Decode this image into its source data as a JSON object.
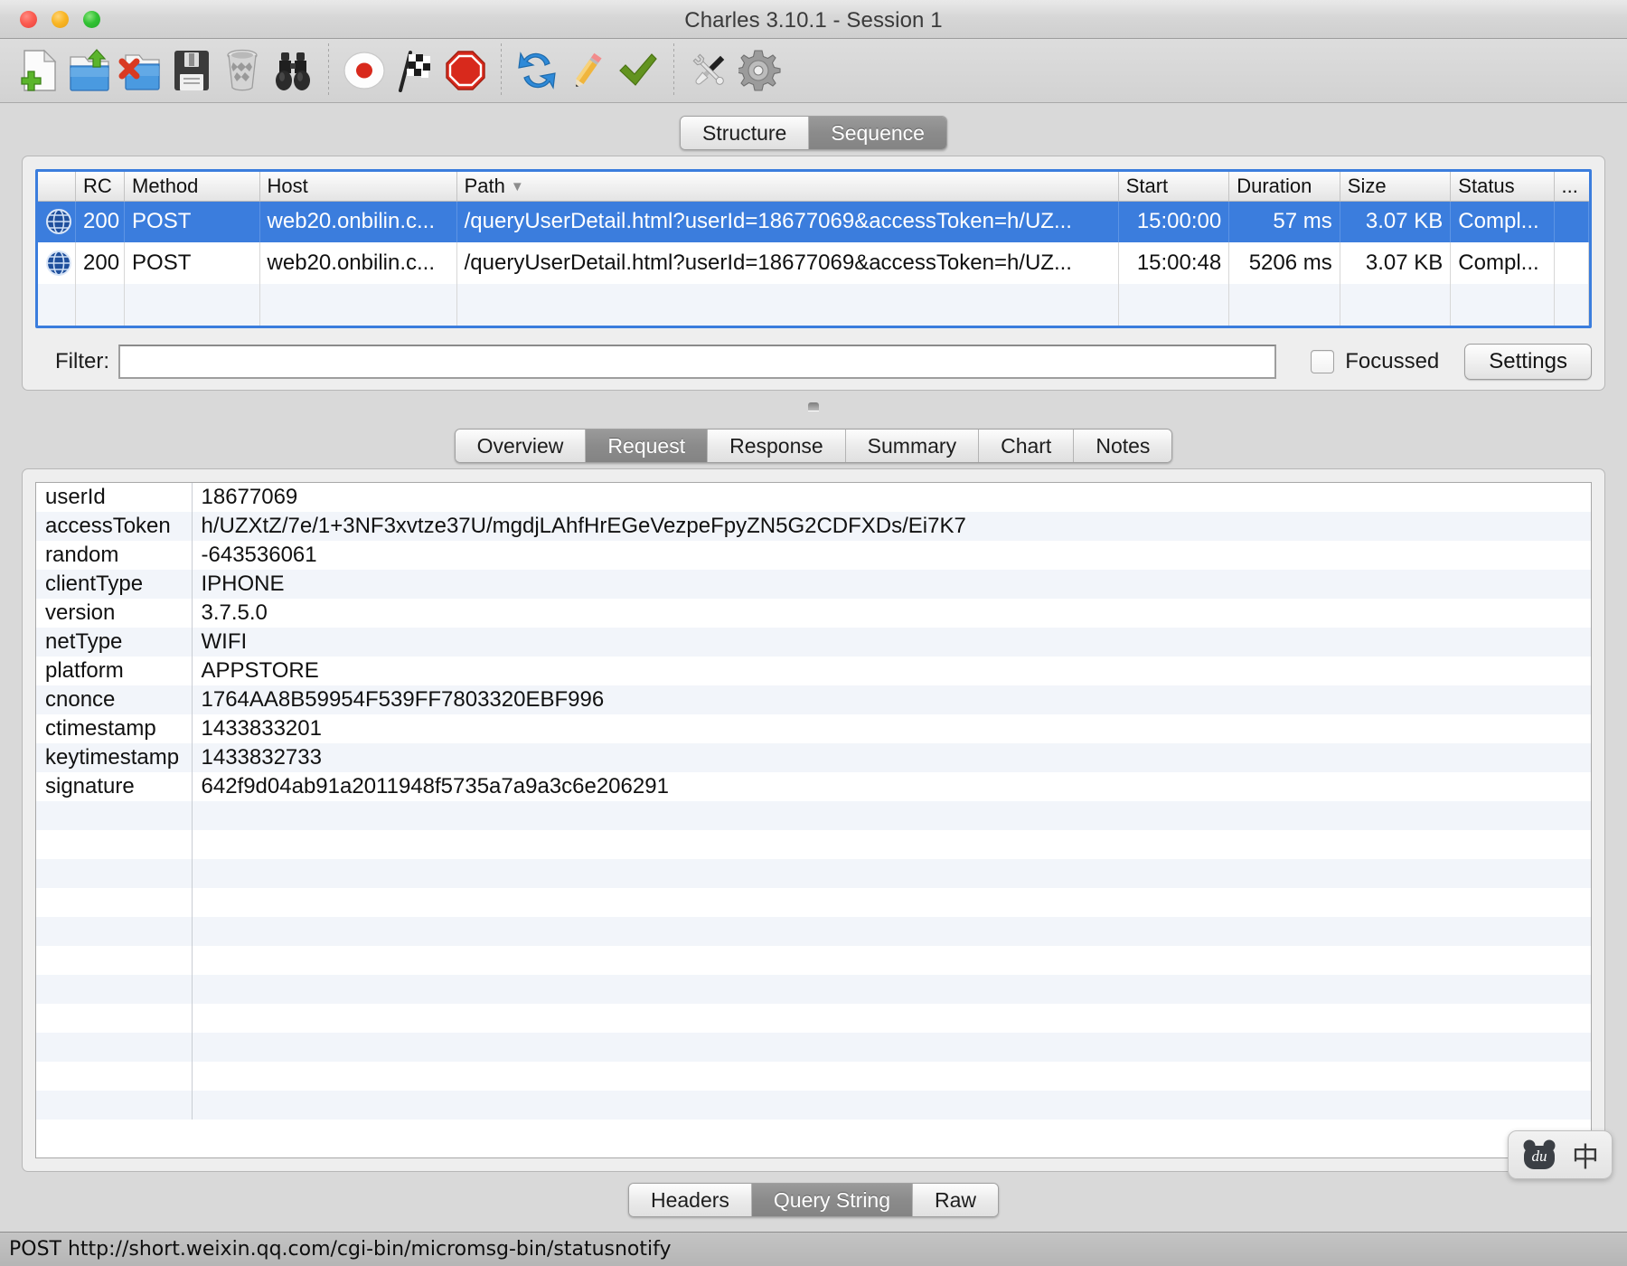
{
  "window": {
    "title": "Charles 3.10.1 - Session 1",
    "traffic_lights": [
      "close-red",
      "minimize-yellow",
      "maximize-green"
    ]
  },
  "toolbar": {
    "groups": [
      [
        {
          "icon": "new-session-icon",
          "label": "New Session"
        },
        {
          "icon": "open-session-icon",
          "label": "Open Session"
        },
        {
          "icon": "close-session-icon",
          "label": "Close Session"
        },
        {
          "icon": "save-session-icon",
          "label": "Save Session"
        },
        {
          "icon": "clear-session-icon",
          "label": "Clear Session"
        },
        {
          "icon": "binoculars-icon",
          "label": "Find"
        }
      ],
      [
        {
          "icon": "record-icon",
          "label": "Start Recording"
        },
        {
          "icon": "throttle-flag-icon",
          "label": "Throttle Settings"
        },
        {
          "icon": "breakpoint-stop-icon",
          "label": "Breakpoints"
        }
      ],
      [
        {
          "icon": "repeat-refresh-icon",
          "label": "Repeat"
        },
        {
          "icon": "compose-pencil-icon",
          "label": "Compose"
        },
        {
          "icon": "validate-check-icon",
          "label": "Validate"
        }
      ],
      [
        {
          "icon": "tools-icon",
          "label": "Tools"
        },
        {
          "icon": "gear-icon",
          "label": "Settings"
        }
      ]
    ]
  },
  "view_tabs": {
    "items": [
      {
        "label": "Structure",
        "active": false
      },
      {
        "label": "Sequence",
        "active": true
      }
    ]
  },
  "request_list": {
    "columns": [
      "",
      "RC",
      "Method",
      "Host",
      "Path",
      "Start",
      "Duration",
      "Size",
      "Status",
      "..."
    ],
    "sorted_column": "Path",
    "sort_direction": "descending",
    "rows": [
      {
        "icon": "globe-icon",
        "rc": "200",
        "method": "POST",
        "host": "web20.onbilin.c...",
        "path": "/queryUserDetail.html?userId=18677069&accessToken=h/UZ...",
        "start": "15:00:00",
        "duration": "57 ms",
        "size": "3.07 KB",
        "status": "Compl...",
        "extra": "",
        "selected": true
      },
      {
        "icon": "globe-icon",
        "rc": "200",
        "method": "POST",
        "host": "web20.onbilin.c...",
        "path": "/queryUserDetail.html?userId=18677069&accessToken=h/UZ...",
        "start": "15:00:48",
        "duration": "5206 ms",
        "size": "3.07 KB",
        "status": "Compl...",
        "extra": "",
        "selected": false
      }
    ],
    "empty_row_count": 1
  },
  "filter_bar": {
    "label": "Filter:",
    "value": "",
    "placeholder": "",
    "focussed_label": "Focussed",
    "focussed_checked": false,
    "settings_label": "Settings"
  },
  "detail_tabs": {
    "items": [
      {
        "label": "Overview",
        "active": false
      },
      {
        "label": "Request",
        "active": true
      },
      {
        "label": "Response",
        "active": false
      },
      {
        "label": "Summary",
        "active": false
      },
      {
        "label": "Chart",
        "active": false
      },
      {
        "label": "Notes",
        "active": false
      }
    ]
  },
  "query_string": {
    "rows": [
      {
        "key": "userId",
        "value": "18677069"
      },
      {
        "key": "accessToken",
        "value": "h/UZXtZ/7e/1+3NF3xvtze37U/mgdjLAhfHrEGeVezpeFpyZN5G2CDFXDs/Ei7K7"
      },
      {
        "key": "random",
        "value": "-643536061"
      },
      {
        "key": "clientType",
        "value": "IPHONE"
      },
      {
        "key": "version",
        "value": "3.7.5.0"
      },
      {
        "key": "netType",
        "value": "WIFI"
      },
      {
        "key": "platform",
        "value": "APPSTORE"
      },
      {
        "key": "cnonce",
        "value": "1764AA8B59954F539FF7803320EBF996"
      },
      {
        "key": "ctimestamp",
        "value": "1433833201"
      },
      {
        "key": "keytimestamp",
        "value": "1433832733"
      },
      {
        "key": "signature",
        "value": "642f9d04ab91a2011948f5735a7a9a3c6e206291"
      }
    ],
    "empty_row_count": 11
  },
  "body_tabs": {
    "items": [
      {
        "label": "Headers",
        "active": false
      },
      {
        "label": "Query String",
        "active": true
      },
      {
        "label": "Raw",
        "active": false
      }
    ]
  },
  "status_bar": {
    "text": "POST http://short.weixin.qq.com/cgi-bin/micromsg-bin/statusnotify"
  },
  "ime_widget": {
    "logo_text": "du",
    "mode_label": "中",
    "logo_icon": "baidu-bear-icon"
  },
  "colors": {
    "selection_blue": "#3b7ddd",
    "window_chrome": "#d9d9d9",
    "alt_row": "#f2f5fa",
    "active_tab": "#8b8b8b"
  }
}
